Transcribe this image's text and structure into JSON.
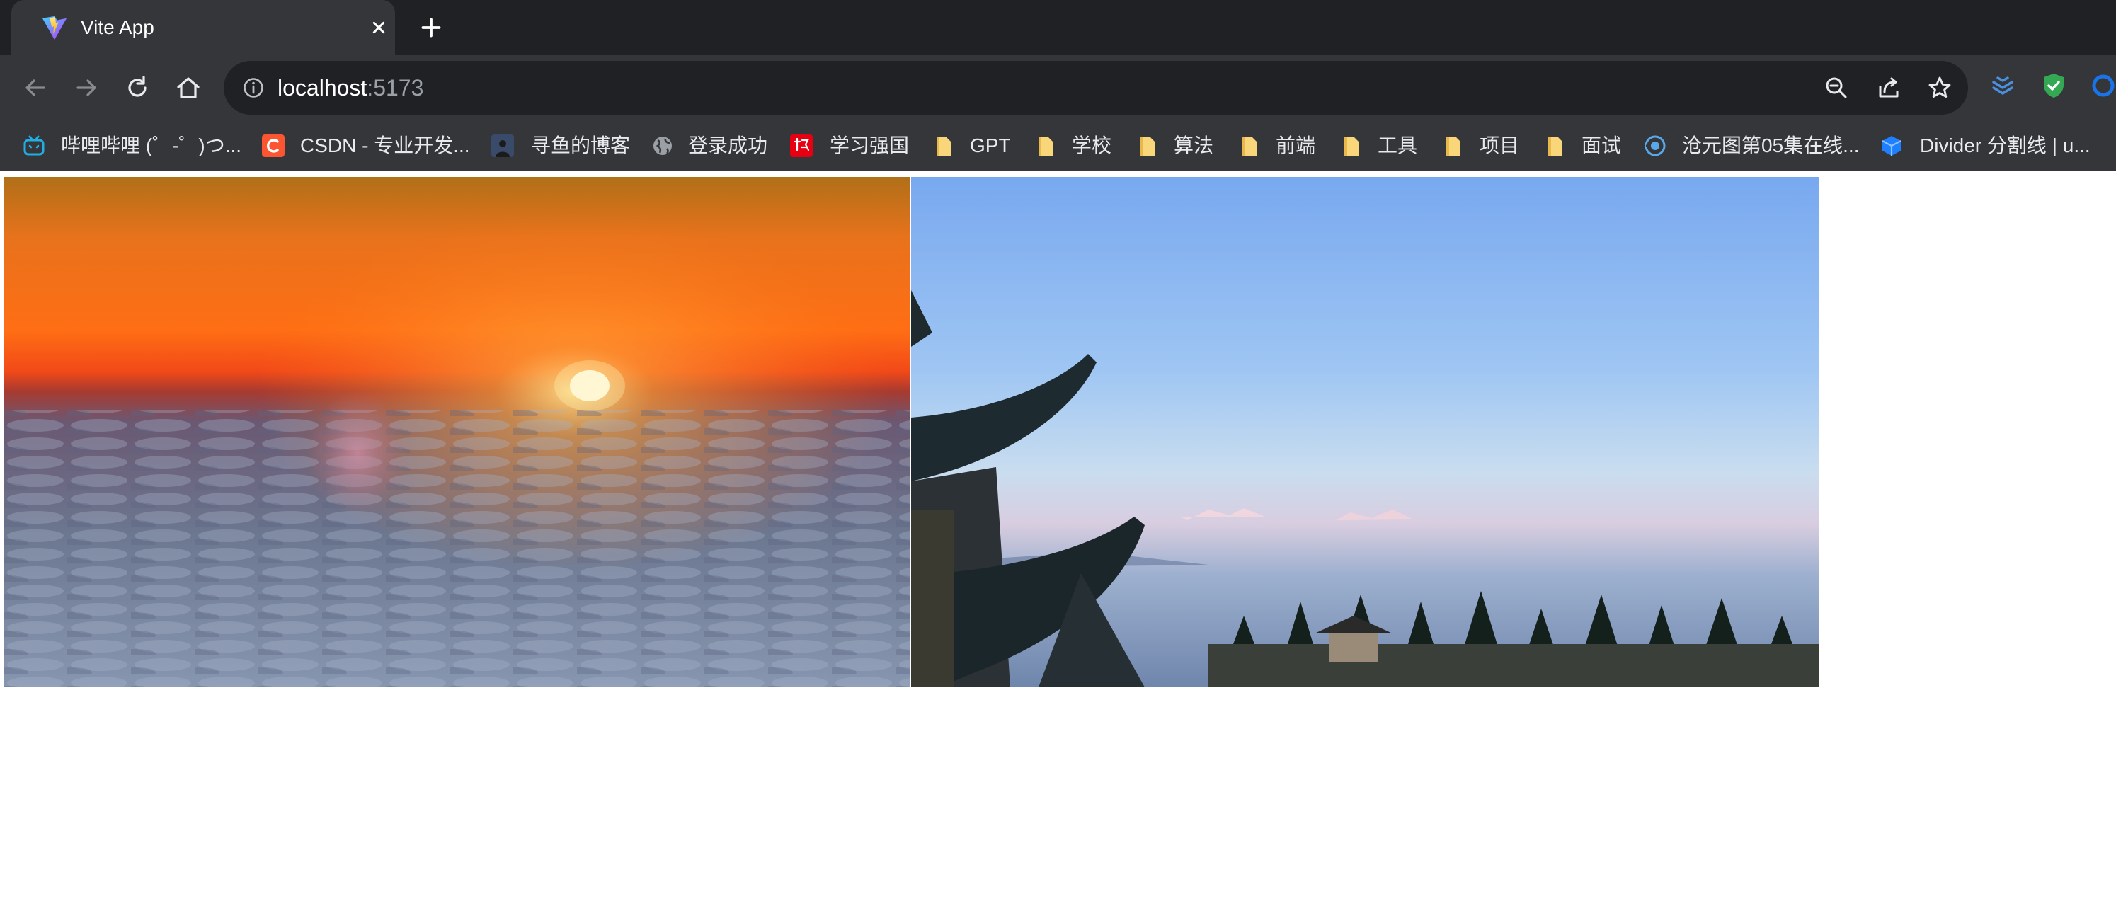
{
  "tab": {
    "title": "Vite App"
  },
  "address": {
    "host": "localhost",
    "port": ":5173"
  },
  "bookmarks": [
    {
      "label": "哔哩哔哩 (゜-゜)つ...",
      "icon": "bilibili-icon"
    },
    {
      "label": "CSDN - 专业开发...",
      "icon": "csdn-icon"
    },
    {
      "label": "寻鱼的博客",
      "icon": "avatar-icon"
    },
    {
      "label": "登录成功",
      "icon": "globe-icon"
    },
    {
      "label": "学习强国",
      "icon": "xuexi-icon"
    },
    {
      "label": "GPT",
      "icon": "folder-icon"
    },
    {
      "label": "学校",
      "icon": "folder-icon"
    },
    {
      "label": "算法",
      "icon": "folder-icon"
    },
    {
      "label": "前端",
      "icon": "folder-icon"
    },
    {
      "label": "工具",
      "icon": "folder-icon"
    },
    {
      "label": "项目",
      "icon": "folder-icon"
    },
    {
      "label": "面试",
      "icon": "folder-icon"
    },
    {
      "label": "沧元图第05集在线...",
      "icon": "video-site-icon"
    },
    {
      "label": "Divider 分割线 | u...",
      "icon": "cube-icon"
    }
  ],
  "images": [
    {
      "name": "sunrise-sea-of-clouds-photo"
    },
    {
      "name": "temple-roof-mountains-photo"
    }
  ],
  "colors": {
    "tabbar": "#202124",
    "toolbar": "#35363a",
    "omnibox": "#202124",
    "text": "#e8eaed",
    "folder": "#f9d67a"
  }
}
